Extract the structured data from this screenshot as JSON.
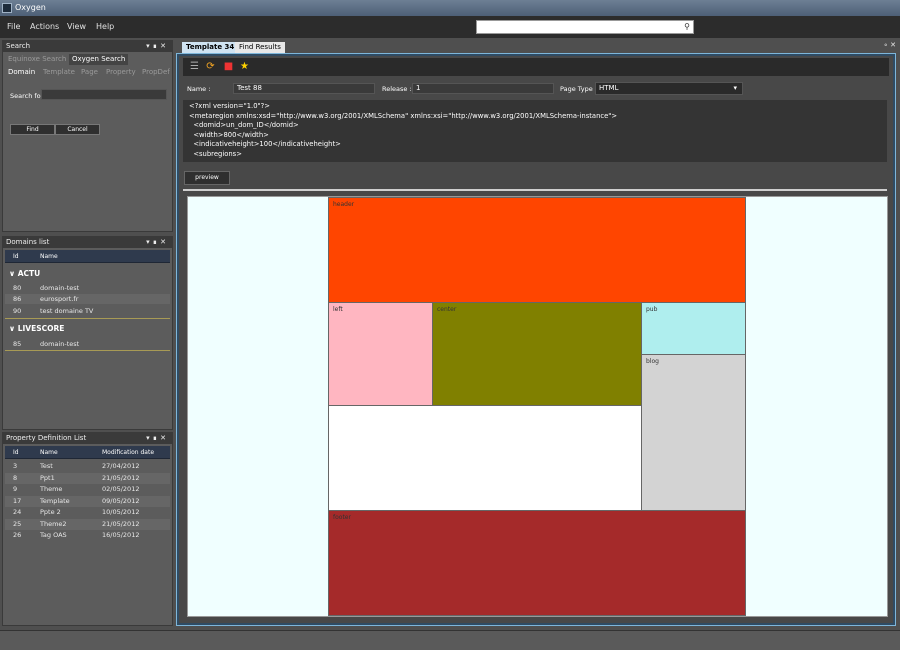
{
  "window": {
    "title": "Oxygen"
  },
  "menu": {
    "items": [
      "File",
      "Actions",
      "View",
      "Help"
    ]
  },
  "search_panel": {
    "title": "Search",
    "tabs": [
      "Equinoxe Search",
      "Oxygen Search"
    ],
    "subtabs": [
      "Domain",
      "Template",
      "Page",
      "Property",
      "PropDef"
    ],
    "search_label": "Search for",
    "search_value": "",
    "find_label": "Find",
    "cancel_label": "Cancel"
  },
  "domains_panel": {
    "title": "Domains list",
    "columns": [
      "Id",
      "Name"
    ],
    "groups": [
      {
        "name": "ACTU",
        "rows": [
          {
            "id": "80",
            "name": "domain-test"
          },
          {
            "id": "86",
            "name": "eurosport.fr"
          },
          {
            "id": "90",
            "name": "test domaine TV"
          }
        ]
      },
      {
        "name": "LIVESCORE",
        "rows": [
          {
            "id": "85",
            "name": "domain-test"
          }
        ]
      }
    ]
  },
  "props_panel": {
    "title": "Property Definition List",
    "columns": [
      "Id",
      "Name",
      "Modification date"
    ],
    "rows": [
      {
        "id": "3",
        "name": "Test",
        "date": "27/04/2012"
      },
      {
        "id": "8",
        "name": "Ppt1",
        "date": "21/05/2012"
      },
      {
        "id": "9",
        "name": "Theme",
        "date": "02/05/2012"
      },
      {
        "id": "17",
        "name": "Template",
        "date": "09/05/2012"
      },
      {
        "id": "24",
        "name": "Ppte 2",
        "date": "10/05/2012"
      },
      {
        "id": "25",
        "name": "Theme2",
        "date": "21/05/2012"
      },
      {
        "id": "26",
        "name": "Tag OAS",
        "date": "16/05/2012"
      }
    ]
  },
  "main": {
    "tabs": [
      "Template 34",
      "Find Results"
    ],
    "name_label": "Name :",
    "name_value": "Test 88",
    "release_label": "Release :",
    "release_value": "1",
    "pagetype_label": "Page Type :",
    "pagetype_value": "HTML",
    "xml": "<?xml version=\"1.0\"?>\n<metaregion xmlns:xsd=\"http://www.w3.org/2001/XMLSchema\" xmlns:xsi=\"http://www.w3.org/2001/XMLSchema-instance\">\n  <domid>un_dom_ID</domid>\n  <width>800</width>\n  <indicativeheight>100</indicativeheight>\n  <subregions>",
    "preview_label": "preview"
  },
  "regions": [
    {
      "label": "header",
      "color": "#ff4500"
    },
    {
      "label": "left",
      "color": "#ffb6c1"
    },
    {
      "label": "center",
      "color": "#808000"
    },
    {
      "label": "pub",
      "color": "#afeeee"
    },
    {
      "label": "blog",
      "color": "#d3d3d3"
    },
    {
      "label": "",
      "color": "#ffffff"
    },
    {
      "label": "footer",
      "color": "#a52a2a"
    }
  ],
  "colors": {
    "canvas_bg": "#f0ffff",
    "frame_border": "#7eb6da"
  }
}
